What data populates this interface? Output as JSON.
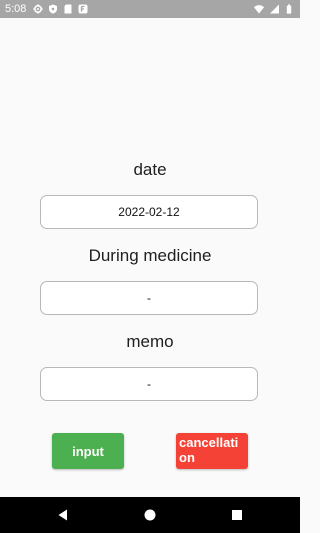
{
  "status_bar": {
    "time": "5:08",
    "left_icons": [
      "gear-icon",
      "shield-icon",
      "sd-card-icon",
      "app-notification-icon"
    ],
    "right_icons": [
      "wifi-icon",
      "signal-icon",
      "battery-icon"
    ]
  },
  "form": {
    "date": {
      "label": "date",
      "value": "2022-02-12"
    },
    "medicine": {
      "label": "During medicine",
      "value": "-"
    },
    "memo": {
      "label": "memo",
      "value": "-"
    }
  },
  "buttons": {
    "input_label": "input",
    "cancel_label": "cancellation"
  },
  "nav_bar": {
    "icons": [
      "back-icon",
      "home-icon",
      "recents-icon"
    ]
  },
  "colors": {
    "status_bar": "#a6a6a6",
    "background": "#fafafa",
    "input_button": "#4caf50",
    "cancel_button": "#f44336",
    "nav_bar": "#000000"
  }
}
